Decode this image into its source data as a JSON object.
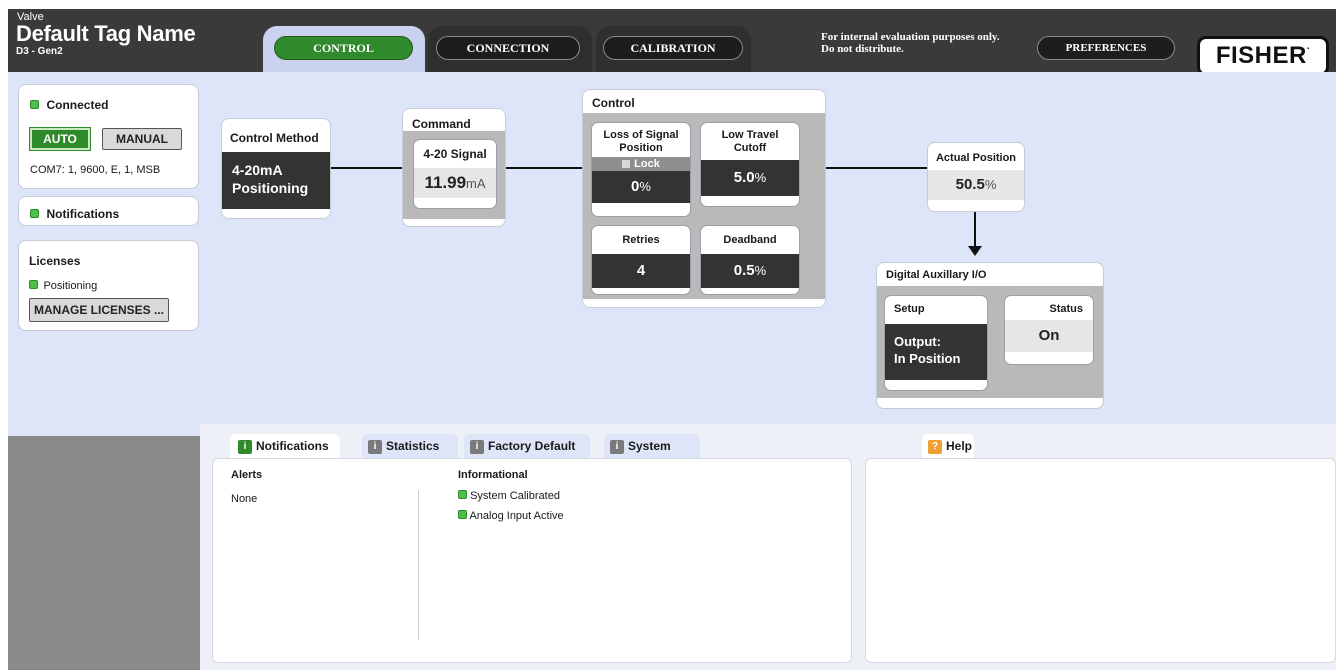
{
  "header": {
    "category": "Valve",
    "tag_name": "Default Tag Name",
    "device": "D3 - Gen2",
    "tabs": [
      "CONTROL",
      "CONNECTION",
      "CALIBRATION"
    ],
    "notice_line1": "For internal evaluation purposes only.",
    "notice_line2": "Do not distribute.",
    "preferences": "PREFERENCES",
    "logo": "FISHER",
    "logo_mark": "."
  },
  "sidebar": {
    "connection_status": "Connected",
    "auto": "AUTO",
    "manual": "MANUAL",
    "com_settings": "COM7: 1, 9600, E, 1, MSB",
    "notifications": "Notifications",
    "licenses_title": "Licenses",
    "license_item": "Positioning",
    "manage_licenses": "MANAGE LICENSES ..."
  },
  "diagram": {
    "control_method": {
      "title": "Control Method",
      "line1": "4-20mA",
      "line2": "Positioning"
    },
    "command": {
      "title": "Command",
      "signal_title": "4-20 Signal",
      "value": "11.99",
      "unit": "mA"
    },
    "control": {
      "title": "Control",
      "los": {
        "title1": "Loss of Signal",
        "title2": "Position",
        "lock": "Lock",
        "value": "0",
        "unit": "%"
      },
      "ltc": {
        "title1": "Low Travel",
        "title2": "Cutoff",
        "value": "5.0",
        "unit": "%"
      },
      "retries": {
        "title": "Retries",
        "value": "4"
      },
      "deadband": {
        "title": "Deadband",
        "value": "0.5",
        "unit": "%"
      }
    },
    "actual_position": {
      "title": "Actual Position",
      "value": "50.5",
      "unit": "%"
    },
    "aux": {
      "title": "Digital Auxillary I/O",
      "setup_title": "Setup",
      "setup_line1": "Output:",
      "setup_line2": "In Position",
      "status_title": "Status",
      "status_value": "On"
    }
  },
  "bottom": {
    "tabs": [
      "Notifications",
      "Statistics",
      "Factory Default",
      "System"
    ],
    "alerts_title": "Alerts",
    "alerts_value": "None",
    "info_title": "Informational",
    "info_items": [
      "System Calibrated",
      "Analog Input Active"
    ],
    "help_tab": "Help",
    "help_icon": "?",
    "info_icon": "i"
  },
  "colors": {
    "accent_green": "#2f8a2c",
    "status_green": "#4cc04a",
    "header_dark": "#3a3a3a",
    "panel_bg": "#dfe5f8",
    "help_orange": "#f0a030"
  }
}
